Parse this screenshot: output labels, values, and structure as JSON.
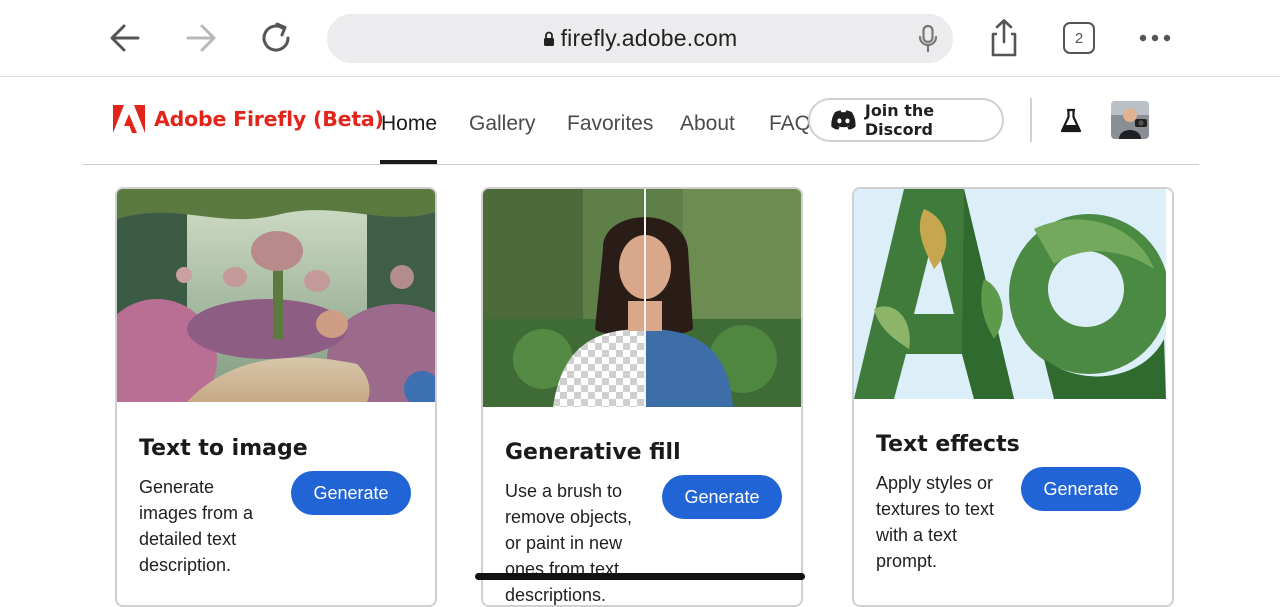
{
  "browser": {
    "url": "firefly.adobe.com",
    "tab_count": "2",
    "icons": [
      "back-arrow-icon",
      "forward-arrow-icon",
      "reload-icon",
      "lock-icon",
      "microphone-icon",
      "share-icon",
      "tabs-icon",
      "more-icon"
    ]
  },
  "header": {
    "brand": "Adobe Firefly (Beta)",
    "nav": [
      {
        "label": "Home",
        "active": true
      },
      {
        "label": "Gallery"
      },
      {
        "label": "Favorites"
      },
      {
        "label": "About"
      },
      {
        "label": "FAQ"
      }
    ],
    "discord_label": "Join the Discord",
    "brand_color": "#e1251b"
  },
  "cards": [
    {
      "title": "Text to image",
      "description": [
        "Generate",
        "images from a",
        "detailed text",
        "description."
      ],
      "button": "Generate"
    },
    {
      "title": "Generative fill",
      "description": [
        "Use a brush to",
        "remove objects,",
        "or paint in new",
        "ones from text",
        "descriptions."
      ],
      "button": "Generate"
    },
    {
      "title": "Text effects",
      "description": [
        "Apply styles or",
        "textures to text",
        "with a text",
        "prompt."
      ],
      "button": "Generate"
    }
  ],
  "accent_color": "#2164d6"
}
